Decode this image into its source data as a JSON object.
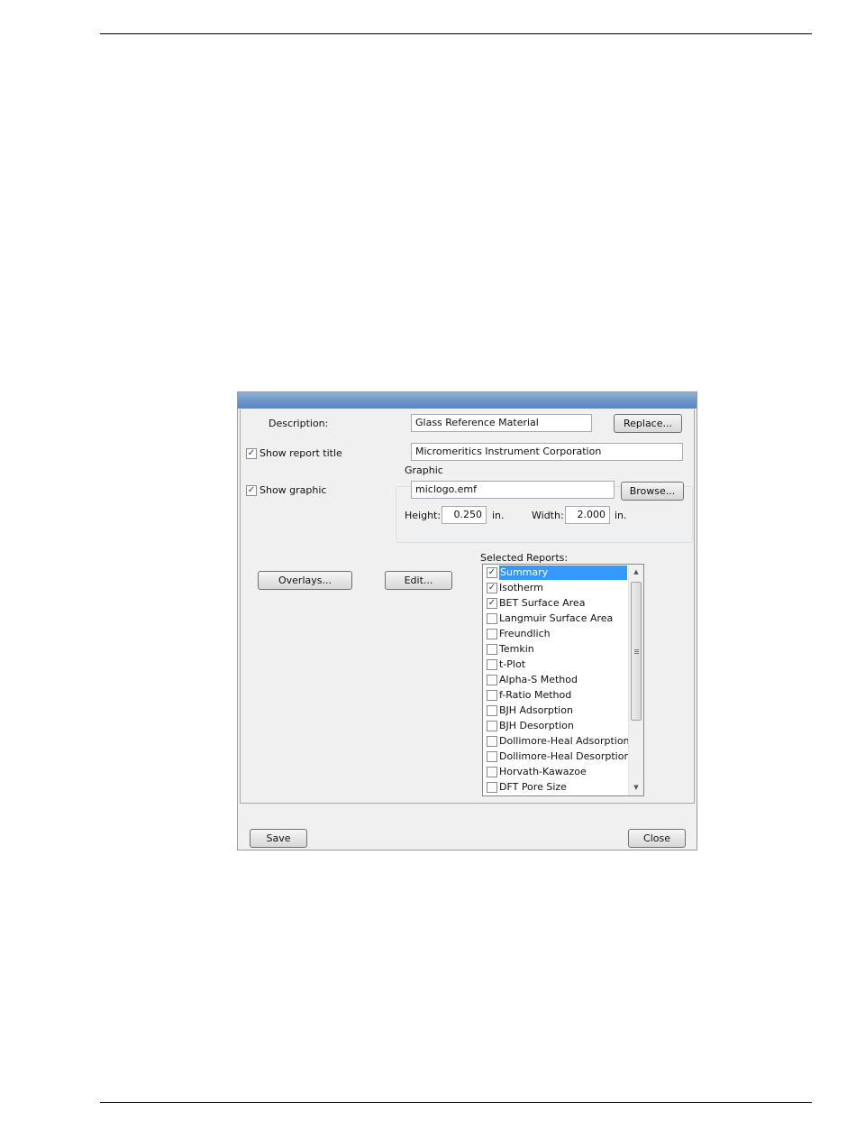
{
  "dialog": {
    "description_label": "Description:",
    "description_value": "Glass Reference Material",
    "replace_button": "Replace...",
    "show_report_title_label": "Show report title",
    "show_report_title_checked": true,
    "report_title_value": "Micromeritics Instrument Corporation",
    "graphic_group_title": "Graphic",
    "show_graphic_label": "Show graphic",
    "show_graphic_checked": true,
    "graphic_file_value": "miclogo.emf",
    "browse_button": "Browse...",
    "height_label": "Height:",
    "height_value": "0.250",
    "height_unit": "in.",
    "width_label": "Width:",
    "width_value": "2.000",
    "width_unit": "in.",
    "overlays_button": "Overlays...",
    "edit_button": "Edit...",
    "selected_reports_label": "Selected Reports:",
    "reports": [
      {
        "label": "Summary",
        "checked": true,
        "selected": true
      },
      {
        "label": "Isotherm",
        "checked": true,
        "selected": false
      },
      {
        "label": "BET Surface Area",
        "checked": true,
        "selected": false
      },
      {
        "label": "Langmuir Surface Area",
        "checked": false,
        "selected": false
      },
      {
        "label": "Freundlich",
        "checked": false,
        "selected": false
      },
      {
        "label": "Temkin",
        "checked": false,
        "selected": false
      },
      {
        "label": "t-Plot",
        "checked": false,
        "selected": false
      },
      {
        "label": "Alpha-S Method",
        "checked": false,
        "selected": false
      },
      {
        "label": "f-Ratio Method",
        "checked": false,
        "selected": false
      },
      {
        "label": "BJH Adsorption",
        "checked": false,
        "selected": false
      },
      {
        "label": "BJH Desorption",
        "checked": false,
        "selected": false
      },
      {
        "label": "Dollimore-Heal Adsorption",
        "checked": false,
        "selected": false
      },
      {
        "label": "Dollimore-Heal Desorption",
        "checked": false,
        "selected": false
      },
      {
        "label": "Horvath-Kawazoe",
        "checked": false,
        "selected": false
      },
      {
        "label": "DFT Pore Size",
        "checked": false,
        "selected": false
      }
    ],
    "save_button": "Save",
    "close_button": "Close"
  },
  "colors": {
    "titlebar": "#6d95c8",
    "selection": "#3399ff",
    "dialog_background": "#f0f0f0"
  }
}
